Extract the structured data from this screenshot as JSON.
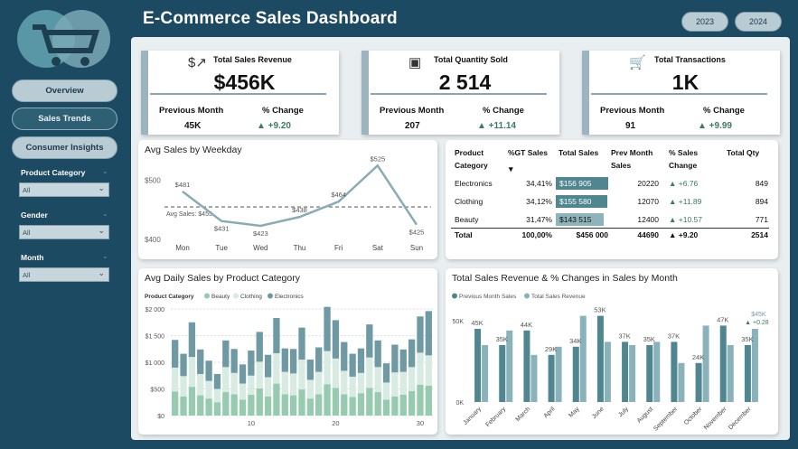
{
  "header": {
    "title": "E-Commerce Sales Dashboard",
    "years": [
      "2023",
      "2024"
    ]
  },
  "sidebar": {
    "nav": [
      "Overview",
      "Sales Trends",
      "Consumer Insights"
    ],
    "filters": [
      {
        "label": "Product Category",
        "value": "All"
      },
      {
        "label": "Gender",
        "value": "All"
      },
      {
        "label": "Month",
        "value": "All"
      }
    ]
  },
  "kpis": [
    {
      "title": "Total Sales Revenue",
      "value": "$456K",
      "prev_label": "Previous Month",
      "prev_value": "45K",
      "change_label": "% Change",
      "change_value": "▲ +9.20",
      "icon": "money-growth-icon"
    },
    {
      "title": "Total Quantity Sold",
      "value": "2 514",
      "prev_label": "Previous Month",
      "prev_value": "207",
      "change_label": "% Change",
      "change_value": "▲ +11.14",
      "icon": "hand-boxes-icon"
    },
    {
      "title": "Total Transactions",
      "value": "1K",
      "prev_label": "Previous Month",
      "prev_value": "91",
      "change_label": "% Change",
      "change_value": "▲ +9.99",
      "icon": "shopping-cart-icon"
    }
  ],
  "weekday": {
    "title": "Avg Sales by Weekday",
    "avg_label": "Avg Sales: $455",
    "y_ticks": [
      "$500",
      "$400"
    ]
  },
  "table": {
    "headers": [
      "Product Category",
      "%GT Sales",
      "Total Sales",
      "Prev Month Sales",
      "% Sales Change",
      "Total Qty"
    ],
    "rows": [
      {
        "category": "Electronics",
        "gt": "34,41%",
        "total": "$156 905",
        "prev": "20220",
        "change": "▲ +6.76",
        "qty": "849",
        "fill": 1.0
      },
      {
        "category": "Clothing",
        "gt": "34,12%",
        "total": "$155 580",
        "prev": "12070",
        "change": "▲ +11.89",
        "qty": "894",
        "fill": 0.99
      },
      {
        "category": "Beauty",
        "gt": "31,47%",
        "total": "$143 515",
        "prev": "12400",
        "change": "▲ +10.57",
        "qty": "771",
        "fill": 0.91
      }
    ],
    "total": {
      "category": "Total",
      "gt": "100,00%",
      "total": "$456 000",
      "prev": "44690",
      "change": "▲ +9.20",
      "qty": "2514"
    }
  },
  "daily": {
    "title": "Avg Daily Sales by Product Category",
    "legend_title": "Product Category",
    "y_ticks": [
      "$2 000",
      "$1 500",
      "$1 000",
      "$500",
      "$0"
    ],
    "x_ticks": [
      "10",
      "20",
      "30"
    ]
  },
  "monthly": {
    "title": "Total Sales Revenue & % Changes in Sales by Month",
    "tooltip_change": "▲ +0.28"
  },
  "colors": {
    "sidebar": "#1d4a63",
    "accent": "#9bb4bf",
    "positive": "#3b7a64",
    "beauty": "#96cbb0",
    "clothing": "#d7ebe2",
    "electronics": "#6f9aa4",
    "prev_month": "#4f868f",
    "total_rev": "#8ab2bb"
  },
  "chart_data": [
    {
      "type": "line",
      "title": "Avg Sales by Weekday",
      "categories": [
        "Mon",
        "Tue",
        "Wed",
        "Thu",
        "Fri",
        "Sat",
        "Sun"
      ],
      "values": [
        481,
        431,
        423,
        438,
        464,
        525,
        425
      ],
      "labels": [
        "$481",
        "$431",
        "$423",
        "$438",
        "$464",
        "$525",
        "$425"
      ],
      "reference_line": 455,
      "ylim": [
        400,
        530
      ]
    },
    {
      "type": "bar",
      "stacked": true,
      "title": "Avg Daily Sales by Product Category",
      "x": [
        1,
        2,
        3,
        4,
        5,
        6,
        7,
        8,
        9,
        10,
        11,
        12,
        13,
        14,
        15,
        16,
        17,
        18,
        19,
        20,
        21,
        22,
        23,
        24,
        25,
        26,
        27,
        28,
        29,
        30,
        31
      ],
      "series": [
        {
          "name": "Beauty",
          "values": [
            450,
            360,
            540,
            380,
            320,
            250,
            440,
            400,
            300,
            390,
            510,
            360,
            600,
            400,
            380,
            490,
            320,
            400,
            590,
            520,
            400,
            350,
            420,
            520,
            440,
            300,
            360,
            390,
            460,
            580,
            560
          ]
        },
        {
          "name": "Clothing",
          "values": [
            450,
            380,
            560,
            400,
            330,
            250,
            470,
            400,
            300,
            360,
            500,
            360,
            570,
            420,
            410,
            560,
            350,
            420,
            620,
            550,
            440,
            380,
            380,
            570,
            470,
            320,
            450,
            430,
            450,
            600,
            570
          ]
        },
        {
          "name": "Electronics",
          "values": [
            520,
            420,
            650,
            460,
            380,
            280,
            500,
            450,
            360,
            470,
            560,
            420,
            660,
            440,
            460,
            600,
            380,
            460,
            830,
            720,
            540,
            430,
            460,
            620,
            500,
            360,
            520,
            420,
            520,
            680,
            830
          ]
        }
      ],
      "ylim": [
        0,
        2000
      ],
      "x_ticks": [
        "10",
        "20",
        "30"
      ],
      "y_ticks": [
        "$2 000",
        "$1 500",
        "$1 000",
        "$500",
        "$0"
      ]
    },
    {
      "type": "bar",
      "title": "Total Sales Revenue & % Changes in Sales by Month",
      "categories": [
        "January",
        "February",
        "March",
        "April",
        "May",
        "June",
        "July",
        "August",
        "September",
        "October",
        "November",
        "December"
      ],
      "series": [
        {
          "name": "Previous Month Sales",
          "values": [
            45,
            35,
            44,
            29,
            34,
            53,
            37,
            35,
            37,
            24,
            47,
            35
          ]
        },
        {
          "name": "Total Sales Revenue",
          "values": [
            35,
            44,
            29,
            34,
            53,
            37,
            35,
            37,
            24,
            47,
            35,
            45
          ]
        }
      ],
      "labels": [
        "45K",
        "35K",
        "44K",
        "29K",
        "34K",
        "53K",
        "37K",
        "35K",
        "37K",
        "24K",
        "47K",
        "35K"
      ],
      "last_label": "$45K",
      "y_ticks": [
        "50K",
        "0K"
      ],
      "ylim": [
        0,
        60
      ]
    }
  ]
}
